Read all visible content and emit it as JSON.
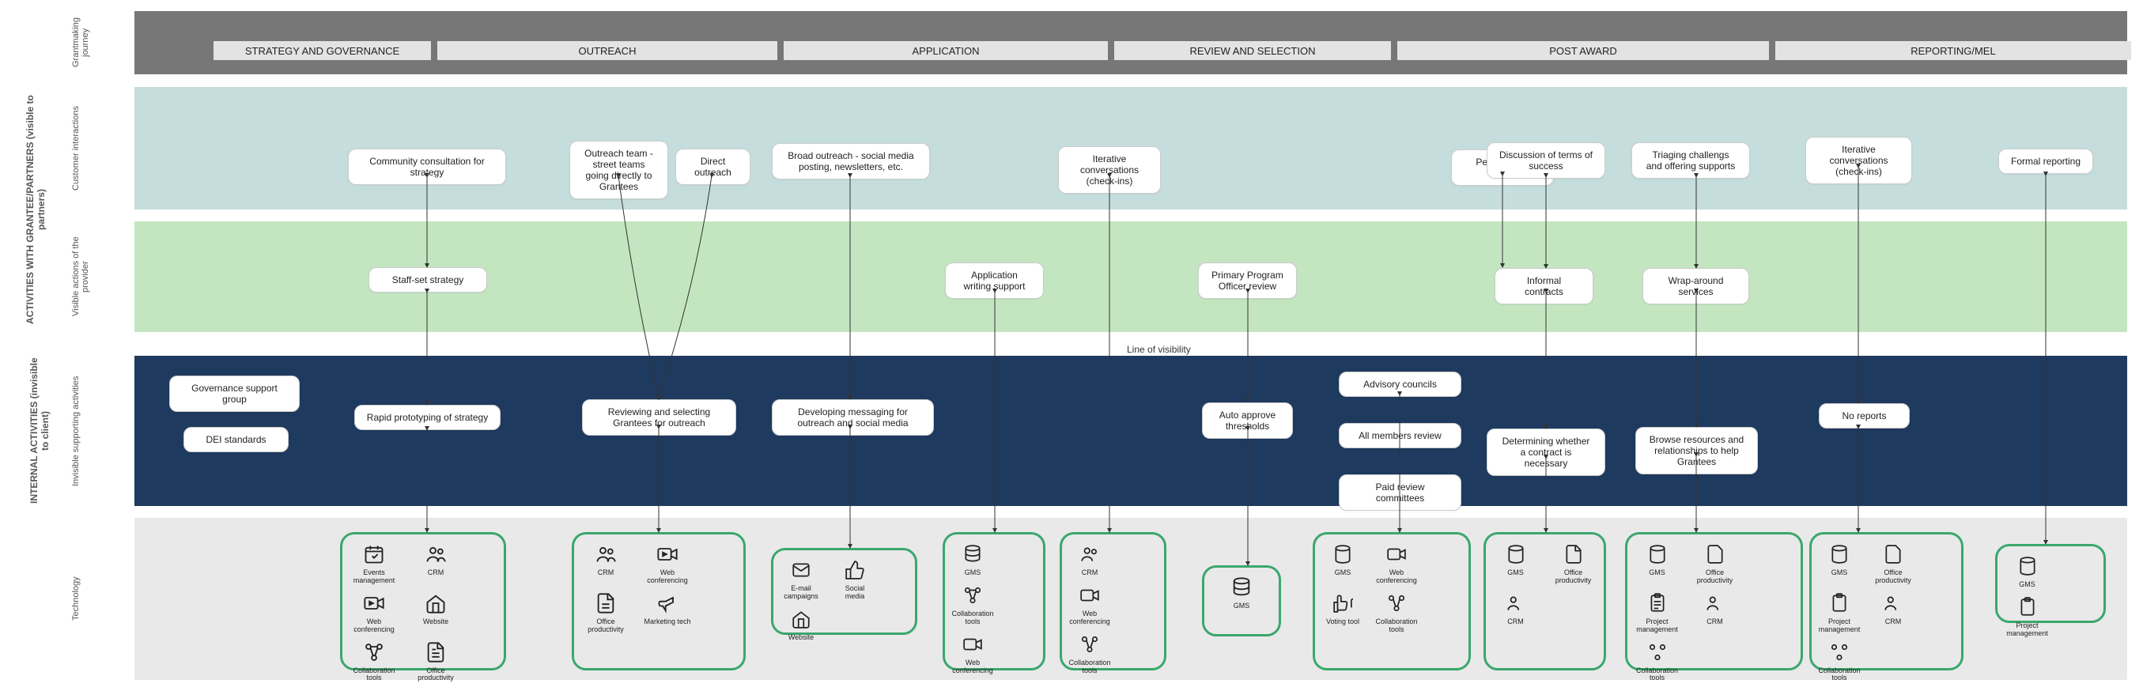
{
  "phases": {
    "strategy": "STRATEGY AND GOVERNANCE",
    "outreach": "OUTREACH",
    "application": "APPLICATION",
    "review": "REVIEW AND SELECTION",
    "postaward": "POST AWARD",
    "reporting": "REPORTING/MEL"
  },
  "row_labels": {
    "journey": "Grantmaking journey",
    "interactions": "Customer interactions",
    "visible_actions": "Visible actions of the provider",
    "activities_with": "ACTIVITIES WITH GRANTEE/PARTNERS (visible to partners)",
    "invisible_support": "Invisible supporting activities",
    "internal": "INTERNAL ACTIVITIES (invisible to client)",
    "technology": "Technology"
  },
  "line_of_visibility": "Line of visibility",
  "cards": {
    "strategy_consult": "Community consultation for strategy",
    "strategy_staffset": "Staff-set strategy",
    "strategy_gov_support": "Governance support group",
    "strategy_dei": "DEI standards",
    "strategy_rapid": "Rapid prototyping of strategy",
    "outreach_team": "Outreach team - street teams going directly to Grantees",
    "outreach_direct": "Direct outreach",
    "outreach_broad": "Broad outreach - social media posting, newsletters, etc.",
    "outreach_review_select": "Reviewing and selecting Grantees for outreach",
    "outreach_messaging": "Developing messaging for outreach and social media",
    "app_iterative": "Iterative conversations (check-ins)",
    "app_writing": "Application writing support",
    "app_primary_review": "Primary Program Officer review",
    "app_auto_approve": "Auto approve thresholds",
    "review_peer": "Peer-to-peer review",
    "review_advisory": "Advisory councils",
    "review_allmembers": "All members review",
    "review_paid": "Paid review committees",
    "review_terms": "Discussion of terms of success",
    "review_informal": "Informal contracts",
    "review_contract_necessary": "Determining whether a contract is necessary",
    "post_triaging": "Triaging challengs and offering supports",
    "post_wrap": "Wrap-around services",
    "post_browse": "Browse resources and relationships to help Grantees",
    "report_iterative": "Iterative conversations (check-ins)",
    "report_formal": "Formal reporting",
    "report_none": "No reports"
  },
  "tech": {
    "events_mgmt": "Events management",
    "crm": "CRM",
    "web_conf": "Web conferencing",
    "website": "Website",
    "collab": "Collaboration tools",
    "office": "Office productivity",
    "marketing": "Marketing tech",
    "email_camp": "E-mail campaigns",
    "social": "Social media",
    "gms": "GMS",
    "voting": "Voting tool",
    "project_mgmt": "Project management"
  }
}
